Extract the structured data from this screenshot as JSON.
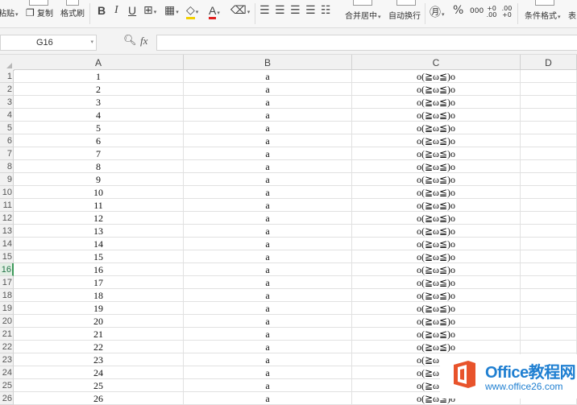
{
  "ribbon": {
    "paste": "粘贴",
    "copy": "复制",
    "format_painter": "格式刷",
    "bold": "B",
    "italic": "I",
    "underline": "U",
    "merge_center": "合并居中",
    "wrap_text": "自动换行",
    "percent": "%",
    "thousands": "000",
    "increase_decimal": "+0 .00",
    "decrease_decimal": ".00 +0",
    "conditional_format": "条件格式",
    "table_style": "表"
  },
  "formula_bar": {
    "name_box": "G16",
    "fx": "fx",
    "value": ""
  },
  "sheet": {
    "columns": [
      "A",
      "B",
      "C",
      "D"
    ],
    "selected_row": 16,
    "rows": [
      {
        "n": "1",
        "a": "1",
        "b": "a",
        "c": "o(≧ω≦)o"
      },
      {
        "n": "2",
        "a": "2",
        "b": "a",
        "c": "o(≧ω≦)o"
      },
      {
        "n": "3",
        "a": "3",
        "b": "a",
        "c": "o(≧ω≦)o"
      },
      {
        "n": "4",
        "a": "4",
        "b": "a",
        "c": "o(≧ω≦)o"
      },
      {
        "n": "5",
        "a": "5",
        "b": "a",
        "c": "o(≧ω≦)o"
      },
      {
        "n": "6",
        "a": "6",
        "b": "a",
        "c": "o(≧ω≦)o"
      },
      {
        "n": "7",
        "a": "7",
        "b": "a",
        "c": "o(≧ω≦)o"
      },
      {
        "n": "8",
        "a": "8",
        "b": "a",
        "c": "o(≧ω≦)o"
      },
      {
        "n": "9",
        "a": "9",
        "b": "a",
        "c": "o(≧ω≦)o"
      },
      {
        "n": "10",
        "a": "10",
        "b": "a",
        "c": "o(≧ω≦)o"
      },
      {
        "n": "11",
        "a": "11",
        "b": "a",
        "c": "o(≧ω≦)o"
      },
      {
        "n": "12",
        "a": "12",
        "b": "a",
        "c": "o(≧ω≦)o"
      },
      {
        "n": "13",
        "a": "13",
        "b": "a",
        "c": "o(≧ω≦)o"
      },
      {
        "n": "14",
        "a": "14",
        "b": "a",
        "c": "o(≧ω≦)o"
      },
      {
        "n": "15",
        "a": "15",
        "b": "a",
        "c": "o(≧ω≦)o"
      },
      {
        "n": "16",
        "a": "16",
        "b": "a",
        "c": "o(≧ω≦)o"
      },
      {
        "n": "17",
        "a": "17",
        "b": "a",
        "c": "o(≧ω≦)o"
      },
      {
        "n": "18",
        "a": "18",
        "b": "a",
        "c": "o(≧ω≦)o"
      },
      {
        "n": "19",
        "a": "19",
        "b": "a",
        "c": "o(≧ω≦)o"
      },
      {
        "n": "20",
        "a": "20",
        "b": "a",
        "c": "o(≧ω≦)o"
      },
      {
        "n": "21",
        "a": "21",
        "b": "a",
        "c": "o(≧ω≦)o"
      },
      {
        "n": "22",
        "a": "22",
        "b": "a",
        "c": "o(≧ω≦)o"
      },
      {
        "n": "23",
        "a": "23",
        "b": "a",
        "c": "o(≧ω≦)o"
      },
      {
        "n": "24",
        "a": "24",
        "b": "a",
        "c": "o(≧ω≦)o"
      },
      {
        "n": "25",
        "a": "25",
        "b": "a",
        "c": "o(≧ω≦)o"
      },
      {
        "n": "26",
        "a": "26",
        "b": "a",
        "c": "o(≧ω≦)o"
      }
    ]
  },
  "watermark": {
    "name": "Office教程网",
    "url": "www.office26.com",
    "logo_color": "#e8532b",
    "text_color": "#1f7fd1"
  }
}
